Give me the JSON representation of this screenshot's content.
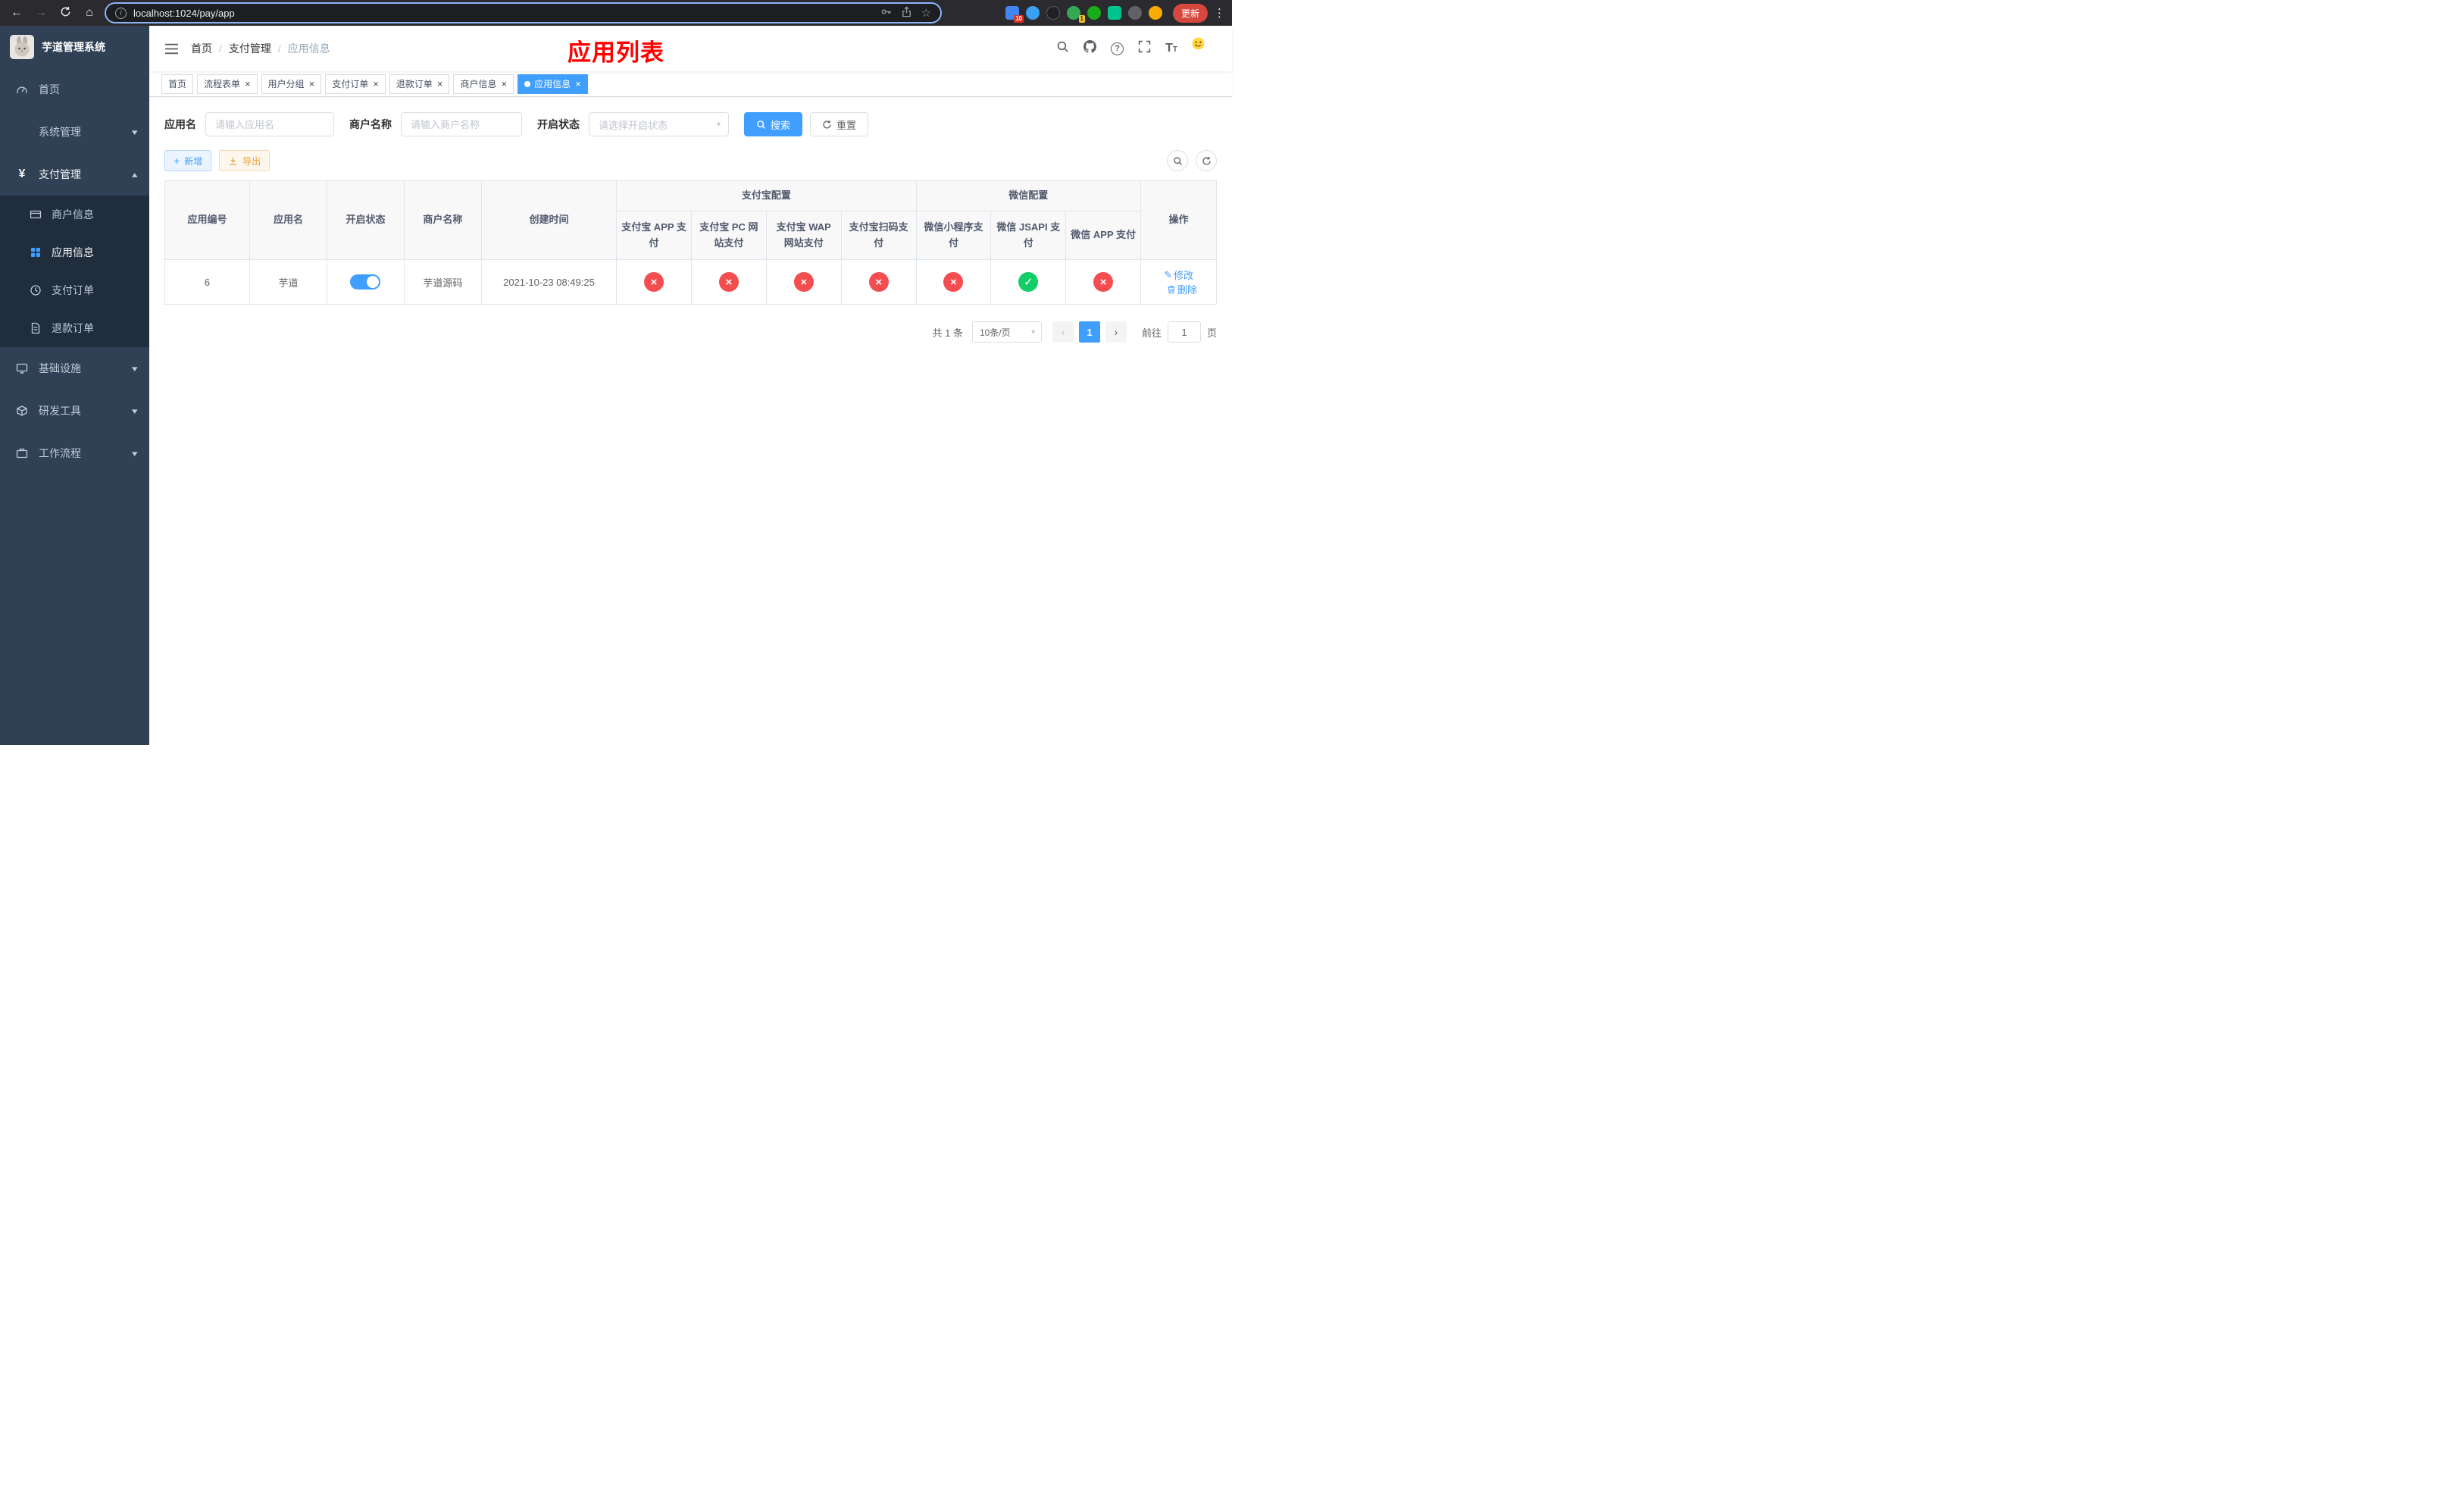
{
  "browser": {
    "url": "localhost:1024/pay/app",
    "update_label": "更新",
    "extension_badge_1": "10",
    "extension_badge_2": "1"
  },
  "icons": {
    "back": "←",
    "forward": "→",
    "home": "⌂",
    "info": "i",
    "star": "☆",
    "dots": "⋮",
    "close": "×",
    "chevron_down": "▾",
    "chevron_up": "▴",
    "check": "✓",
    "cross": "×",
    "plus": "+",
    "edit": "✎",
    "question": "?",
    "font_size_big": "T",
    "font_size_small": "T",
    "yen": "¥",
    "slash": "/",
    "prev": "‹",
    "next": "›"
  },
  "sidebar": {
    "logo_title": "芋道管理系统",
    "items_top": [
      {
        "label": "首页"
      },
      {
        "label": "系统管理"
      },
      {
        "label": "支付管理"
      }
    ],
    "submenu": [
      {
        "label": "商户信息"
      },
      {
        "label": "应用信息"
      },
      {
        "label": "支付订单"
      },
      {
        "label": "退款订单"
      }
    ],
    "items_bottom": [
      {
        "label": "基础设施"
      },
      {
        "label": "研发工具"
      },
      {
        "label": "工作流程"
      }
    ]
  },
  "header": {
    "breadcrumb": [
      "首页",
      "支付管理",
      "应用信息"
    ],
    "page_title": "应用列表"
  },
  "tabs": [
    {
      "label": "首页"
    },
    {
      "label": "流程表单"
    },
    {
      "label": "用户分组"
    },
    {
      "label": "支付订单"
    },
    {
      "label": "退款订单"
    },
    {
      "label": "商户信息"
    },
    {
      "label": "应用信息"
    }
  ],
  "filters": {
    "app_name_label": "应用名",
    "app_name_placeholder": "请输入应用名",
    "merchant_label": "商户名称",
    "merchant_placeholder": "请输入商户名称",
    "status_label": "开启状态",
    "status_placeholder": "请选择开启状态",
    "search_label": "搜索",
    "reset_label": "重置"
  },
  "toolbar": {
    "add_label": "新增",
    "export_label": "导出"
  },
  "table": {
    "header": {
      "app_id": "应用编号",
      "app_name": "应用名",
      "status": "开启状态",
      "merchant": "商户名称",
      "created": "创建时间",
      "alipay_group": "支付宝配置",
      "alipay_1": "支付宝 APP 支付",
      "alipay_2": "支付宝 PC 网站支付",
      "alipay_3": "支付宝 WAP 网站支付",
      "alipay_4": "支付宝扫码支付",
      "wechat_group": "微信配置",
      "wechat_1": "微信小程序支付",
      "wechat_2": "微信 JSAPI 支付",
      "wechat_3": "微信 APP 支付",
      "actions": "操作"
    },
    "row": {
      "app_id": "6",
      "app_name": "芋道",
      "enabled": true,
      "merchant": "芋道源码",
      "created": "2021-10-23 08:49:25",
      "statuses": [
        "closed",
        "closed",
        "closed",
        "closed",
        "closed",
        "open",
        "closed"
      ],
      "edit": "修改",
      "delete": "删除"
    }
  },
  "pagination": {
    "total": "共 1 条",
    "page_size": "10条/页",
    "current_page": "1",
    "goto_prefix": "前往",
    "goto_value": "1",
    "goto_suffix": "页"
  },
  "colors": {
    "accent": "#409eff",
    "danger": "#f34d50",
    "success": "#12ce66",
    "title_red": "#ff0000",
    "sidebar_bg": "#304156",
    "submenu_bg": "#1f2d3d",
    "table_header_bg": "#f8f8f9"
  }
}
